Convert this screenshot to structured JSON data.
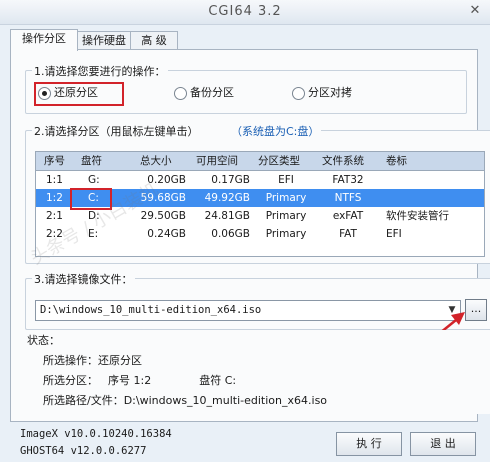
{
  "window": {
    "title": "CGI64  3.2",
    "close_glyph": "✕"
  },
  "tabs": [
    {
      "label": "操作分区",
      "active": true
    },
    {
      "label": "操作硬盘",
      "active": false
    },
    {
      "label": "高 级",
      "active": false
    }
  ],
  "operation": {
    "label": "1.请选择您要进行的操作：",
    "options": [
      {
        "label": "还原分区",
        "selected": true
      },
      {
        "label": "备份分区",
        "selected": false
      },
      {
        "label": "分区对拷",
        "selected": false
      }
    ]
  },
  "partition": {
    "label": "2.请选择分区（用鼠标左键单击）",
    "system_note": "（系统盘为C:盘）",
    "columns": [
      "序号",
      "盘符",
      "总大小",
      "可用空间",
      "分区类型",
      "文件系统",
      "卷标"
    ],
    "rows": [
      [
        "1:1",
        "G:",
        "0.20GB",
        "0.17GB",
        "EFI",
        "FAT32",
        ""
      ],
      [
        "1:2",
        "C:",
        "59.68GB",
        "49.92GB",
        "Primary",
        "NTFS",
        ""
      ],
      [
        "2:1",
        "D:",
        "29.50GB",
        "24.81GB",
        "Primary",
        "exFAT",
        "软件安装管行"
      ],
      [
        "2:2",
        "E:",
        "0.24GB",
        "0.06GB",
        "Primary",
        "FAT",
        "EFI"
      ]
    ],
    "selected_row": 1
  },
  "image": {
    "label": "3.请选择镜像文件：",
    "path": "D:\\windows_10_multi-edition_x64.iso",
    "browse_label": "...",
    "dropdown_glyph": "▼"
  },
  "status": {
    "label": "状态：",
    "operation_text": "所选操作：还原分区",
    "partition_prefix": "所选分区：",
    "serial_label": "序号 1:2",
    "drive_label": "盘符 C:",
    "path_text": "所选路径/文件：D:\\windows_10_multi-edition_x64.iso"
  },
  "footer": {
    "imagex": "ImageX v10.0.10240.16384",
    "ghost": "GHOST64 v12.0.0.6277"
  },
  "buttons": {
    "exec": "执 行",
    "exit": "退 出"
  },
  "watermark": {
    "text": "头条号 / 小白装机"
  }
}
